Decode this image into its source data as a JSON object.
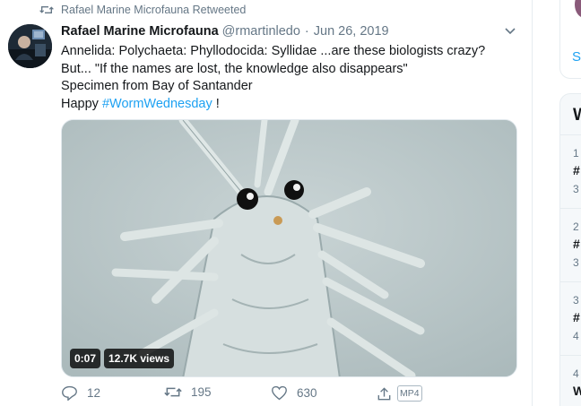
{
  "retweet": {
    "text": "Rafael Marine Microfauna Retweeted"
  },
  "tweet": {
    "author_name": "Rafael Marine Microfauna",
    "handle": "@rmartinledo",
    "separator": "·",
    "date": "Jun 26, 2019",
    "lines": [
      "Annelida: Polychaeta: Phyllodocida: Syllidae ...are these biologists crazy?",
      "But... \"If the names are lost, the knowledge also disappears\"",
      "Specimen from Bay of Santander"
    ],
    "last_line_prefix": "Happy ",
    "hashtag": "#WormWednesday",
    "last_line_suffix": " !",
    "video": {
      "time": "0:07",
      "views": "12.7K views"
    },
    "actions": {
      "replies": "12",
      "retweets": "195",
      "likes": "630",
      "mp4_label": "MP4"
    }
  },
  "sidebar": {
    "top_link": "S",
    "trends_title": "W",
    "trends": [
      {
        "rank": "1",
        "tag": "#",
        "count": "3"
      },
      {
        "rank": "2",
        "tag": "#",
        "count": "3"
      },
      {
        "rank": "3",
        "tag": "#",
        "count": "4"
      },
      {
        "rank": "4",
        "tag": "W",
        "count": ""
      }
    ]
  },
  "colors": {
    "accent": "#1da1f2",
    "secondary_text": "#657786",
    "primary_text": "#14171a"
  },
  "icons": [
    "retweet-icon",
    "caret-down-icon",
    "reply-icon",
    "retweet-icon",
    "like-icon",
    "share-icon"
  ]
}
